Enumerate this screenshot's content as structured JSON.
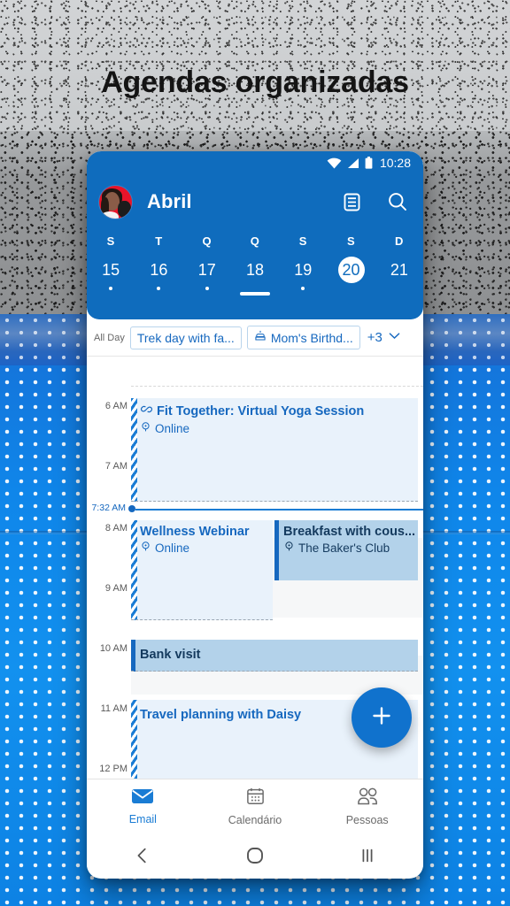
{
  "promo": {
    "headline": "Agendas organizadas"
  },
  "status_bar": {
    "time": "10:28",
    "icons": [
      "wifi-icon",
      "signal-icon",
      "battery-icon"
    ]
  },
  "app_bar": {
    "avatar": "user-avatar",
    "title": "Abril",
    "agenda_icon": "agenda-list-icon",
    "search_icon": "search-icon"
  },
  "week": {
    "dows": [
      "S",
      "T",
      "Q",
      "Q",
      "S",
      "S",
      "D"
    ],
    "days": [
      {
        "num": "15",
        "dot": true,
        "selected": false,
        "bar": false
      },
      {
        "num": "16",
        "dot": true,
        "selected": false,
        "bar": false
      },
      {
        "num": "17",
        "dot": true,
        "selected": false,
        "bar": false
      },
      {
        "num": "18",
        "dot": false,
        "selected": false,
        "bar": true
      },
      {
        "num": "19",
        "dot": true,
        "selected": false,
        "bar": false
      },
      {
        "num": "20",
        "dot": false,
        "selected": true,
        "bar": false
      },
      {
        "num": "21",
        "dot": false,
        "selected": false,
        "bar": false
      }
    ]
  },
  "all_day": {
    "label": "All Day",
    "chips": [
      {
        "text": "Trek day with fa...",
        "icon": null
      },
      {
        "text": "Mom's Birthd...",
        "icon": "cake-icon"
      }
    ],
    "more_count": "+3",
    "expand_icon": "chevron-down-icon"
  },
  "day_grid": {
    "hours": [
      "6 AM",
      "7 AM",
      "8 AM",
      "9 AM",
      "10 AM",
      "11 AM",
      "12 PM"
    ],
    "now": {
      "label": "7:32 AM"
    },
    "events": [
      {
        "title": "Fit Together: Virtual Yoga Session",
        "location": "Online",
        "title_icon": "link-icon",
        "location_icon": "place-pin-icon",
        "style": "tentative"
      },
      {
        "title": "Wellness Webinar",
        "location": "Online",
        "title_icon": null,
        "location_icon": "place-pin-icon",
        "style": "tentative"
      },
      {
        "title": "Breakfast with cous...",
        "location": "The Baker's Club",
        "title_icon": null,
        "location_icon": "place-pin-icon",
        "style": "solid"
      },
      {
        "title": "Bank visit",
        "location": null,
        "title_icon": null,
        "location_icon": null,
        "style": "solid"
      },
      {
        "title": "Travel planning with Daisy",
        "location": null,
        "title_icon": null,
        "location_icon": null,
        "style": "tentative"
      }
    ]
  },
  "fab": {
    "icon": "plus-icon"
  },
  "bottom_nav": {
    "items": [
      {
        "label": "Email",
        "icon": "mail-icon",
        "active": true
      },
      {
        "label": "Calendário",
        "icon": "calendar-icon",
        "active": false
      },
      {
        "label": "Pessoas",
        "icon": "people-icon",
        "active": false
      }
    ]
  },
  "system_nav": {
    "back": "back-icon",
    "home": "home-icon",
    "recents": "recents-icon"
  },
  "colors": {
    "header_blue": "#0f6cbd",
    "accent_blue": "#1a7cd4",
    "tentative_bg": "#e9f2fb",
    "solid_bg": "#b3d2ea",
    "avatar_red": "#e8142a"
  }
}
